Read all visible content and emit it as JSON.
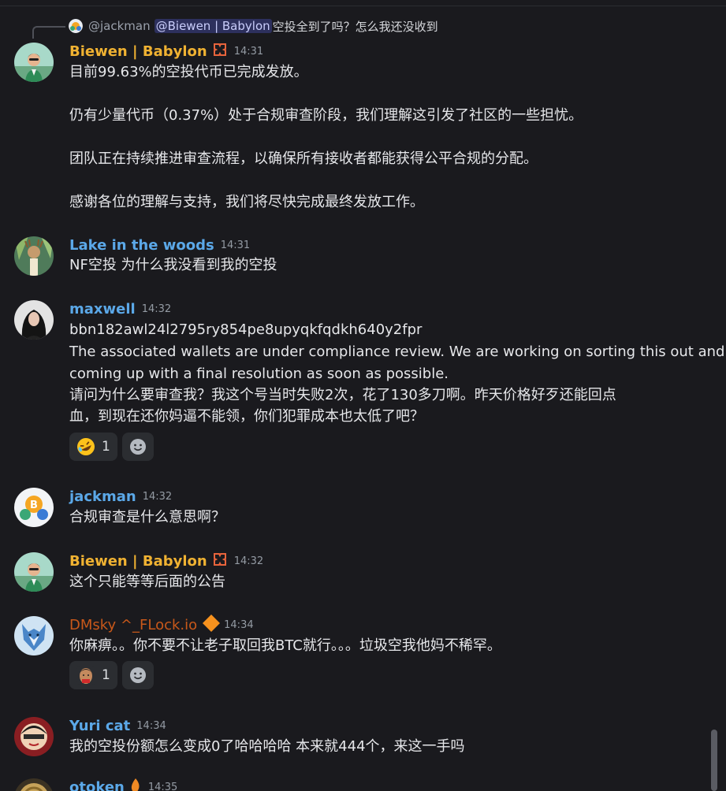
{
  "reply_preview": {
    "author": "@jackman",
    "mention": "@Biewen | Babylon",
    "text": "空投全到了吗？怎么我还没收到"
  },
  "messages": [
    {
      "author": "Biewen | Babylon",
      "author_color": "#f0b232",
      "time": "14:31",
      "has_badge": "team-badge-icon",
      "lines": [
        "目前99.63%的空投代币已完成发放。",
        "仍有少量代币（0.37%）处于合规审查阶段，我们理解这引发了社区的一些担忧。",
        "团队正在持续推进审查流程，以确保所有接收者都能获得公平合规的分配。",
        "感谢各位的理解与支持，我们将尽快完成最终发放工作。"
      ]
    },
    {
      "author": "Lake in the woods",
      "author_color": "#5ba8e8",
      "time": "14:31",
      "lines": [
        "NF空投 为什么我没看到我的空投"
      ]
    },
    {
      "author": "maxwell",
      "author_color": "#5ba8e8",
      "time": "14:32",
      "lines": [
        "bbn182awl24l2795ry854pe8upyqkfqdkh640y2fpr",
        "The associated wallets are under compliance review. We are working on sorting this out and",
        "coming up with a final resolution as soon as possible.",
        "请问为什么要审查我？我这个号当时失败2次，花了130多刀啊。昨天价格好歹还能回点",
        "血，到现在还你妈逼不能领，你们犯罪成本也太低了吧？"
      ],
      "reactions": [
        {
          "emoji": "rofl-emoji",
          "count": "1"
        }
      ]
    },
    {
      "author": "jackman",
      "author_color": "#5ba8e8",
      "time": "14:32",
      "lines": [
        "合规审查是什么意思啊？"
      ]
    },
    {
      "author": "Biewen | Babylon",
      "author_color": "#f0b232",
      "time": "14:32",
      "has_badge": "team-badge-icon",
      "lines": [
        "这个只能等等后面的公告"
      ]
    },
    {
      "author": "DMsky ^_FLock.io",
      "author_color": "#c8581a",
      "time": "14:34",
      "has_badge": "diamond-badge-icon",
      "lines": [
        "你麻痹。。你不要不让老子取回我BTC就行。。。垃圾空我他妈不稀罕。"
      ],
      "reactions": [
        {
          "emoji": "face-emoji",
          "count": "1"
        }
      ]
    },
    {
      "author": "Yuri cat",
      "author_color": "#5ba8e8",
      "time": "14:34",
      "lines": [
        "我的空投份额怎么变成0了哈哈哈哈 本来就444个，来这一手吗"
      ]
    },
    {
      "author": "otoken",
      "author_color": "#5ba8e8",
      "time": "14:35",
      "has_badge": "flame-badge-icon",
      "lines": []
    }
  ]
}
